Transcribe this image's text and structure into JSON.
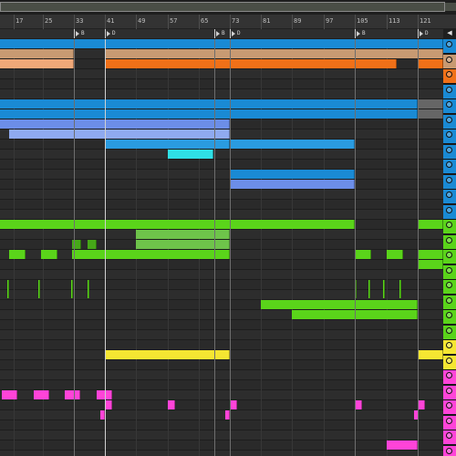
{
  "ruler": {
    "bars": [
      "17",
      "25",
      "33",
      "41",
      "49",
      "57",
      "65",
      "73",
      "81",
      "89",
      "97",
      "105",
      "113",
      "121"
    ]
  },
  "locators": [
    {
      "label": "B",
      "color": "#cfcfcf"
    },
    {
      "label": "D",
      "color": "#cfcfcf"
    },
    {
      "label": "B",
      "color": "#cfcfcf"
    },
    {
      "label": "D",
      "color": "#cfcfcf"
    },
    {
      "label": "B",
      "color": "#cfcfcf"
    },
    {
      "label": "D",
      "color": "#cfcfcf"
    }
  ],
  "colors": {
    "blue": "#1a8ad4",
    "blue_mid": "#2a9be0",
    "periwinkle": "#6c8ee8",
    "light_blue": "#8faaf0",
    "cyan": "#2fe0e6",
    "peach": "#f0a878",
    "orange": "#f07018",
    "tan": "#c89a72",
    "green": "#5ad41a",
    "green_light": "#6ec44a",
    "green_dark": "#46a818",
    "yellow": "#f5e632",
    "magenta": "#ff44d8",
    "grey_clip": "#666666"
  },
  "tracks": [
    {
      "color": "#1a8ad4",
      "icon": "play-icon"
    },
    {
      "color": "#c89a72",
      "icon": "play-icon"
    },
    {
      "color": "#f07018",
      "icon": "play-icon"
    },
    {
      "color": "#1a8ad4",
      "icon": "group-icon"
    },
    {
      "color": "#1a8ad4",
      "icon": "play-icon"
    },
    {
      "color": "#1a8ad4",
      "icon": "play-icon"
    },
    {
      "color": "#1a8ad4",
      "icon": "play-icon"
    },
    {
      "color": "#1a8ad4",
      "icon": "play-icon"
    },
    {
      "color": "#1a8ad4",
      "icon": "play-icon"
    },
    {
      "color": "#1a8ad4",
      "icon": "play-icon"
    },
    {
      "color": "#1a8ad4",
      "icon": "play-icon"
    },
    {
      "color": "#1a8ad4",
      "icon": "play-icon"
    },
    {
      "color": "#5ad41a",
      "icon": "group-icon"
    },
    {
      "color": "#5ad41a",
      "icon": "play-icon"
    },
    {
      "color": "#5ad41a",
      "icon": "play-icon"
    },
    {
      "color": "#5ad41a",
      "icon": "play-icon"
    },
    {
      "color": "#5ad41a",
      "icon": "play-icon"
    },
    {
      "color": "#5ad41a",
      "icon": "play-icon"
    },
    {
      "color": "#5ad41a",
      "icon": "play-icon"
    },
    {
      "color": "#5ad41a",
      "icon": "play-icon"
    },
    {
      "color": "#f5e632",
      "icon": "group-icon"
    },
    {
      "color": "#f5e632",
      "icon": "play-icon"
    },
    {
      "color": "#ff44d8",
      "icon": "group-icon"
    },
    {
      "color": "#ff44d8",
      "icon": "play-icon"
    },
    {
      "color": "#ff44d8",
      "icon": "play-icon"
    },
    {
      "color": "#ff44d8",
      "icon": "play-icon"
    },
    {
      "color": "#ff44d8",
      "icon": "play-icon"
    },
    {
      "color": "#ff44d8",
      "icon": "play-icon"
    }
  ]
}
